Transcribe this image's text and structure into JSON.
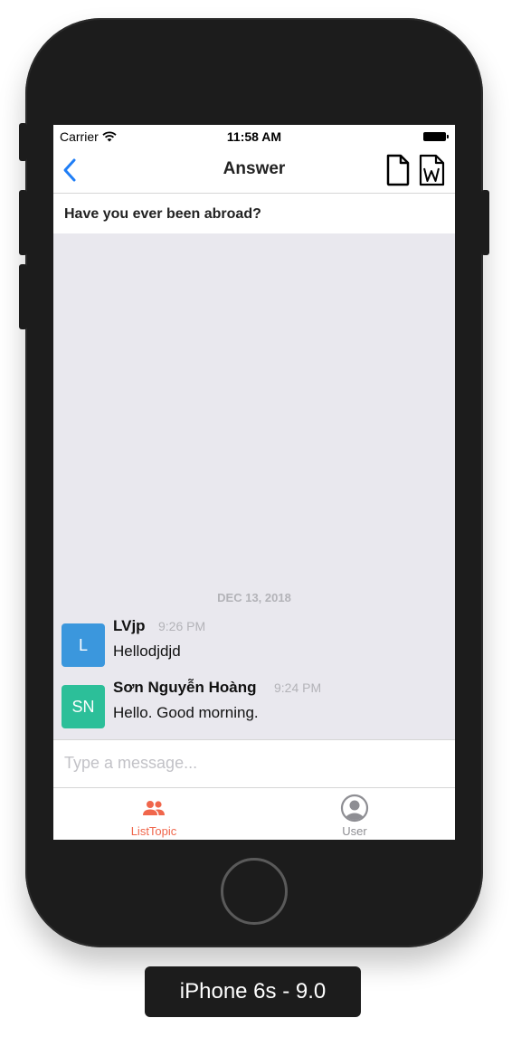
{
  "status_bar": {
    "carrier": "Carrier",
    "time": "11:58 AM"
  },
  "nav": {
    "title": "Answer",
    "doc_icon": "document-icon",
    "word_icon": "word-document-icon"
  },
  "topic": {
    "question": "Have you ever been abroad?"
  },
  "chat": {
    "date_separator": "DEC 13, 2018",
    "messages": [
      {
        "avatar_initials": "L",
        "avatar_color": "#3b97dd",
        "name": "LVjp",
        "time": "9:26 PM",
        "text": "Hellodjdjd"
      },
      {
        "avatar_initials": "SN",
        "avatar_color": "#2cbf99",
        "name": "Sơn Nguyễn Hoàng",
        "time": "9:24 PM",
        "text": "Hello. Good morning."
      }
    ]
  },
  "composer": {
    "placeholder": "Type a message..."
  },
  "tabs": [
    {
      "label": "ListTopic",
      "icon": "people-icon",
      "active": true,
      "color": "#f0664b"
    },
    {
      "label": "User",
      "icon": "user-circle-icon",
      "active": false,
      "color": "#8e8e93"
    }
  ],
  "device_label": "iPhone 6s - 9.0",
  "colors": {
    "accent": "#1f7ef6",
    "chat_background": "#e9e8ee",
    "active_tab": "#f0664b"
  }
}
